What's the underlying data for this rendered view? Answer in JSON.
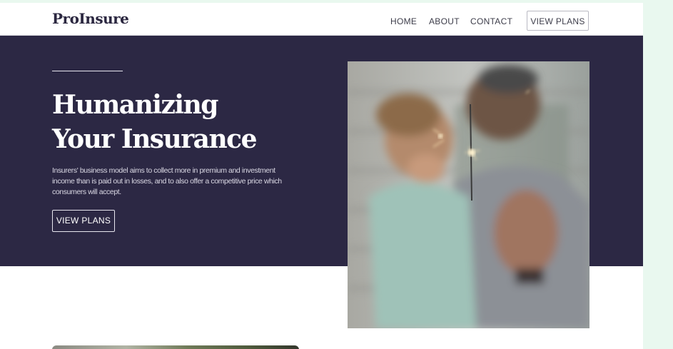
{
  "header": {
    "logo": "ProInsure",
    "nav": [
      "HOME",
      "ABOUT",
      "CONTACT"
    ],
    "cta_label": "VIEW PLANS"
  },
  "hero": {
    "title_line1": "Humanizing",
    "title_line2": "Your Insurance",
    "description": "Insurers' business model aims to collect more in premium and investment income than is paid out in losses, and to also offer a competitive price which consumers will accept.",
    "button_label": "VIEW PLANS"
  },
  "colors": {
    "hero_background": "#2c2844",
    "page_background": "#ffffff",
    "outer_background": "#e9f8ef",
    "text_dark": "#2b2740"
  }
}
